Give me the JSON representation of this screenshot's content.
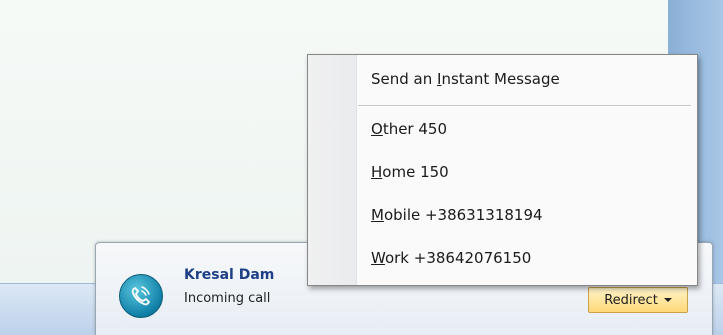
{
  "menu": {
    "items": [
      {
        "accel": "",
        "pre": "Send an ",
        "acc": "I",
        "post": "nstant Message"
      },
      {
        "pre": "",
        "acc": "O",
        "post": "ther 450"
      },
      {
        "pre": "",
        "acc": "H",
        "post": "ome 150"
      },
      {
        "pre": "",
        "acc": "M",
        "post": "obile +38631318194"
      },
      {
        "pre": "",
        "acc": "W",
        "post": "ork +38642076150"
      }
    ]
  },
  "toast": {
    "caller_name": "Kresal Dam",
    "status": "Incoming call",
    "redirect_label": "Redirect",
    "icon": "phone-call-icon"
  },
  "colors": {
    "caller_name": "#1e3f86",
    "redirect_bg": "#ffd978",
    "side_strip": "#8ab0d6"
  }
}
